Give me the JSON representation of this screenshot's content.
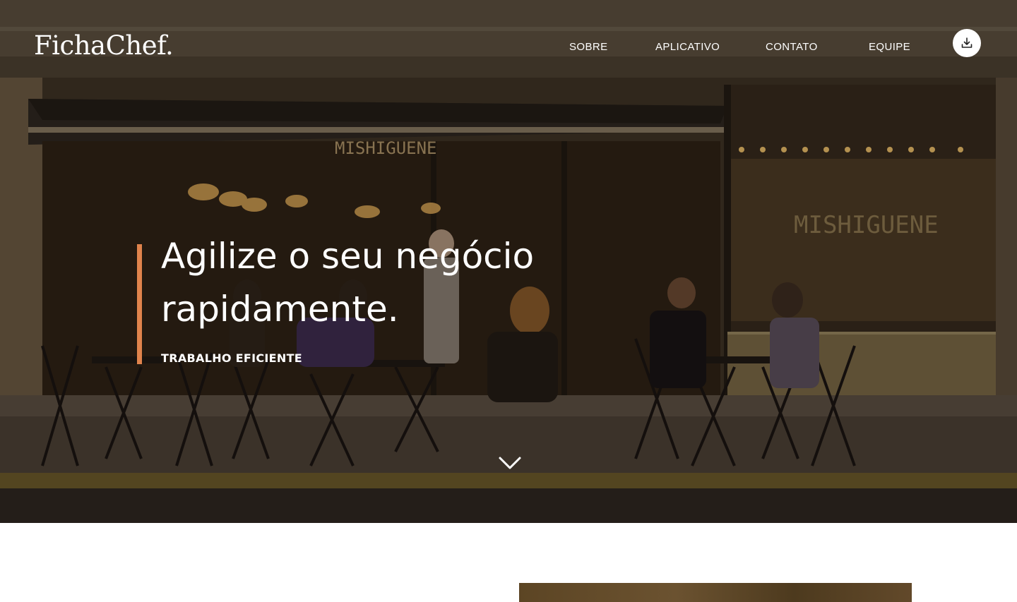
{
  "header": {
    "brand": "FichaChef.",
    "nav": [
      {
        "label": "SOBRE"
      },
      {
        "label": "APLICATIVO"
      },
      {
        "label": "CONTATO"
      },
      {
        "label": "EQUIPE"
      }
    ],
    "download_icon": "download-icon"
  },
  "hero": {
    "headline": "Agilize o seu negócio rapidamente.",
    "subheadline": "TRABALHO EFICIENTE",
    "scroll_icon": "chevron-down-icon",
    "sign_text": "MISHIGUENE",
    "sign_text_2": "MISHIGUENE"
  },
  "colors": {
    "accent": "#e0834c",
    "text": "#ffffff",
    "background": "#ffffff"
  }
}
